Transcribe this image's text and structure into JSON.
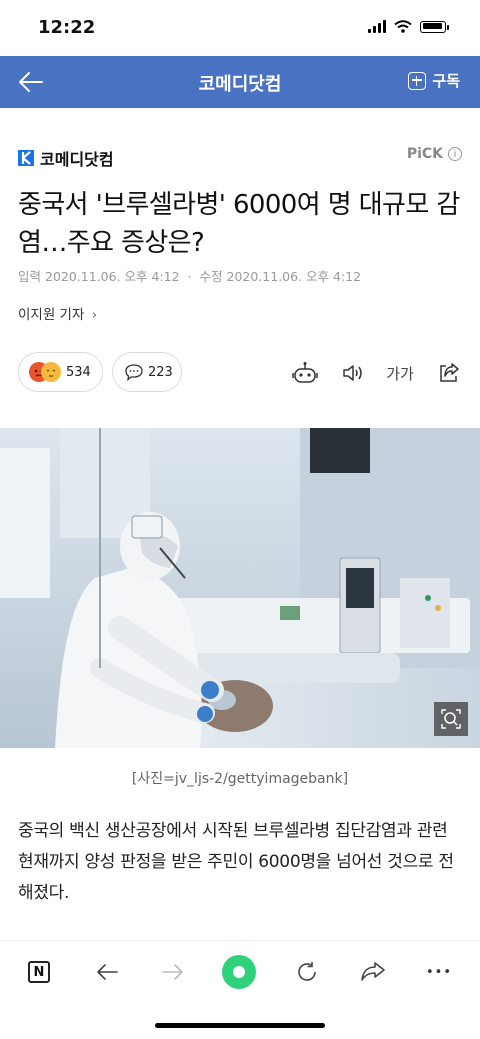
{
  "status": {
    "time": "12:22"
  },
  "nav": {
    "title": "코메디닷컴",
    "subscribe_label": "구독"
  },
  "article": {
    "press_name": "코메디닷컴",
    "pick_label": "PiCK",
    "headline": "중국서 '브루셀라병' 6000여 명 대규모 감염…주요 증상은?",
    "input_label": "입력",
    "input_date": "2020.11.06. 오후 4:12",
    "modified_label": "수정",
    "modified_date": "2020.11.06. 오후 4:12",
    "reporter": "이지원 기자",
    "reaction_count": "534",
    "comment_count": "223",
    "font_size_label": "가가",
    "photo_caption": "[사진=jv_ljs-2/gettyimagebank]",
    "body": "중국의 백신 생산공장에서 시작된 브루셀라병 집단감염과 관련 현재까지 양성 판정을 받은 주민이 6000명을 넘어선 것으로 전해졌다."
  },
  "bottom_bar": {
    "naver_label": "N",
    "more_label": "•••"
  },
  "colors": {
    "accent": "#4a72c2",
    "green": "#2fd27a"
  }
}
